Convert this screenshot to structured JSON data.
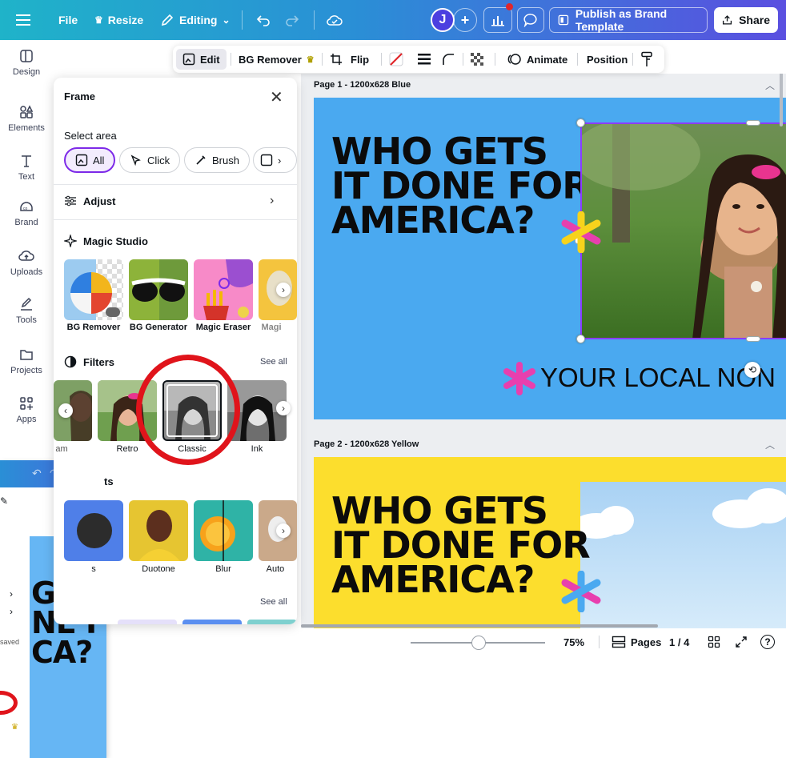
{
  "topbar": {
    "file_label": "File",
    "resize_label": "Resize",
    "editing_label": "Editing",
    "avatar_initial": "J",
    "publish_label": "Publish as Brand Template",
    "share_label": "Share"
  },
  "rail": {
    "items": [
      {
        "label": "Design"
      },
      {
        "label": "Elements"
      },
      {
        "label": "Text"
      },
      {
        "label": "Brand"
      },
      {
        "label": "Uploads"
      },
      {
        "label": "Tools"
      },
      {
        "label": "Projects"
      },
      {
        "label": "Apps"
      }
    ]
  },
  "context_toolbar": {
    "edit_label": "Edit",
    "bg_remover_label": "BG Remover",
    "flip_label": "Flip",
    "animate_label": "Animate",
    "position_label": "Position"
  },
  "panel": {
    "title": "Frame",
    "select_area_label": "Select area",
    "chips": [
      {
        "label": "All"
      },
      {
        "label": "Click"
      },
      {
        "label": "Brush"
      }
    ],
    "adjust_label": "Adjust",
    "magic_studio_label": "Magic Studio",
    "magic_tools": [
      {
        "label": "BG Remover"
      },
      {
        "label": "BG Generator"
      },
      {
        "label": "Magic Eraser"
      },
      {
        "label": "Magi"
      }
    ],
    "filters_label": "Filters",
    "filters_see_all": "See all",
    "filters": [
      {
        "label": "am"
      },
      {
        "label": "Retro"
      },
      {
        "label": "Classic"
      },
      {
        "label": "Ink"
      }
    ],
    "effects_partial_label": "ts",
    "effects": [
      {
        "label": "s"
      },
      {
        "label": "Duotone"
      },
      {
        "label": "Blur"
      },
      {
        "label": "Auto"
      }
    ],
    "effects_see_all": "See all"
  },
  "canvas": {
    "page1_label": "Page 1 - 1200x628 Blue",
    "page1_headline": [
      "WHO GETS",
      "IT DONE FOR",
      "AMERICA?"
    ],
    "page1_tagline": "YOUR LOCAL NON",
    "page2_label": "Page 2 - 1200x628 Yellow",
    "page2_headline": [
      "WHO GETS",
      "IT DONE FOR",
      "AMERICA?"
    ]
  },
  "statusbar": {
    "zoom_value": "75%",
    "pages_label": "Pages",
    "page_count": "1 / 4"
  },
  "inset": {
    "saved_text": "saved",
    "headline_fragment": "GETS\nNE FO\nCA?"
  },
  "colors": {
    "accent_purple": "#8b3dff",
    "page1_bg": "#4aa9f0",
    "page2_bg": "#fcde2d",
    "annotation_red": "#e0141b",
    "star_pink": "#e83fae",
    "star_yellow": "#f7d31c"
  }
}
